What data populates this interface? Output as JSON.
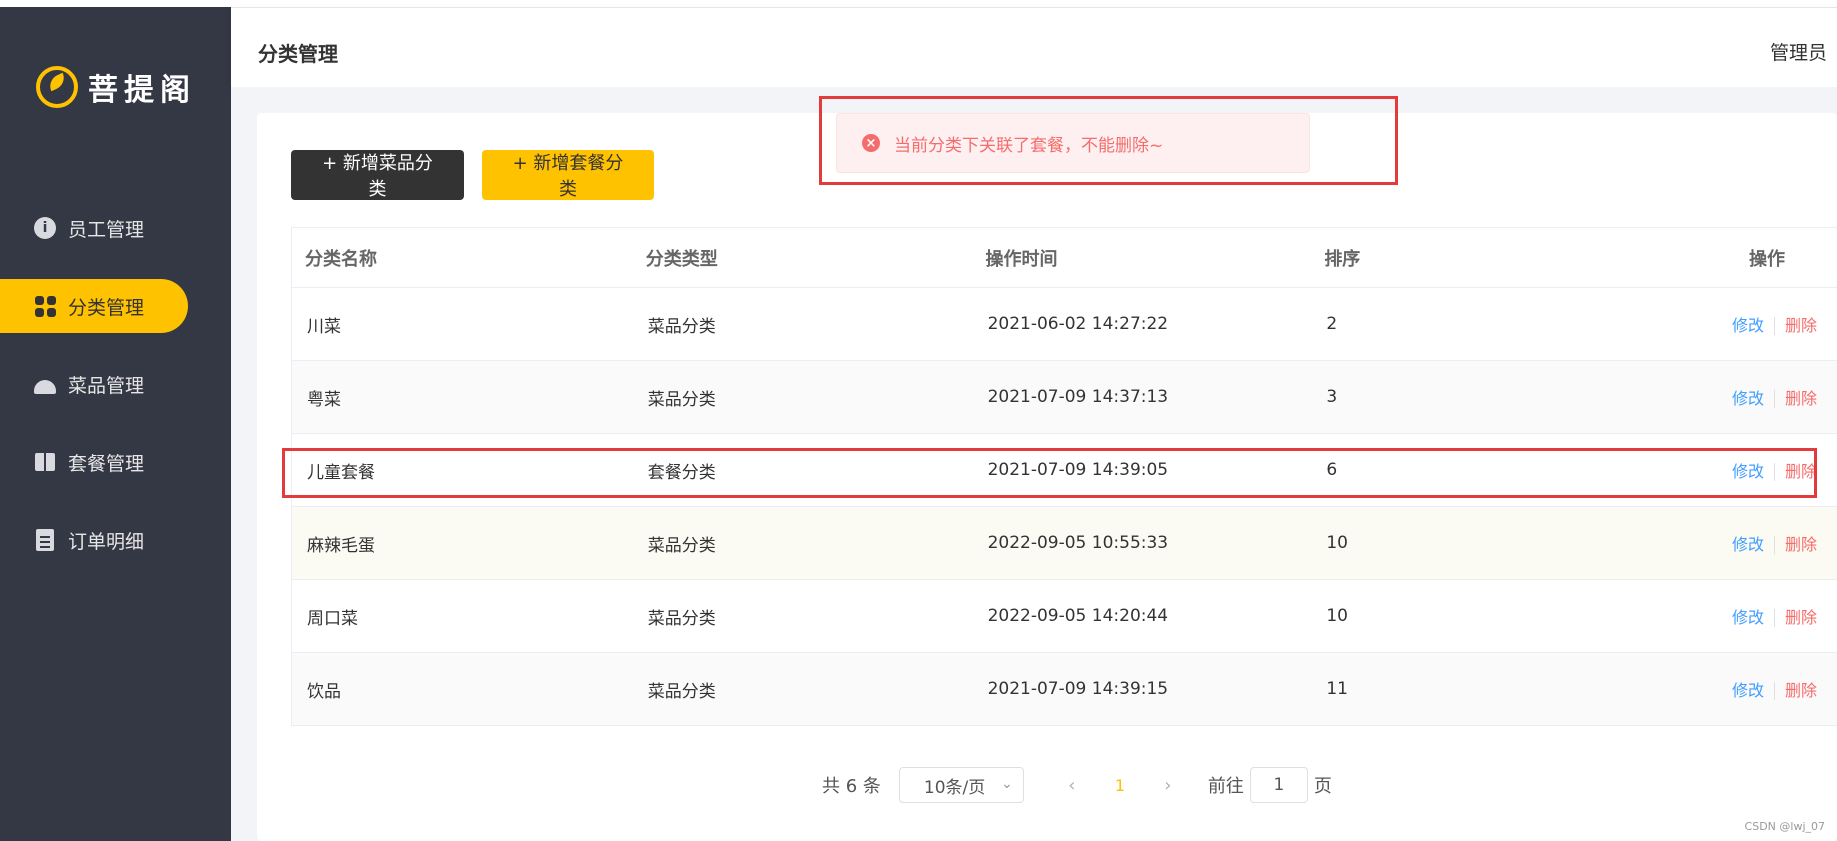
{
  "app": {
    "logo_text": "菩提阁"
  },
  "sidebar": {
    "items": [
      {
        "label": "员工管理",
        "icon": "info-icon",
        "active": false
      },
      {
        "label": "分类管理",
        "icon": "grid-icon",
        "active": true
      },
      {
        "label": "菜品管理",
        "icon": "cloche-icon",
        "active": false
      },
      {
        "label": "套餐管理",
        "icon": "gift-icon",
        "active": false
      },
      {
        "label": "订单明细",
        "icon": "clipboard-icon",
        "active": false
      }
    ]
  },
  "header": {
    "title": "分类管理",
    "user": "管理员"
  },
  "toolbar": {
    "add_dish_category": "+ 新增菜品分类",
    "add_setmeal_category": "+ 新增套餐分类"
  },
  "toast": {
    "type": "error",
    "message": "当前分类下关联了套餐，不能删除~",
    "color": "#f56c6c"
  },
  "table": {
    "headers": {
      "name": "分类名称",
      "type": "分类类型",
      "time": "操作时间",
      "sort": "排序",
      "op": "操作"
    },
    "rows": [
      {
        "name": "川菜",
        "type": "菜品分类",
        "time": "2021-06-02 14:27:22",
        "sort": "2",
        "edit": "修改",
        "del": "删除"
      },
      {
        "name": "粤菜",
        "type": "菜品分类",
        "time": "2021-07-09 14:37:13",
        "sort": "3",
        "edit": "修改",
        "del": "删除"
      },
      {
        "name": "儿童套餐",
        "type": "套餐分类",
        "time": "2021-07-09 14:39:05",
        "sort": "6",
        "edit": "修改",
        "del": "删除"
      },
      {
        "name": "麻辣毛蛋",
        "type": "菜品分类",
        "time": "2022-09-05 10:55:33",
        "sort": "10",
        "edit": "修改",
        "del": "删除"
      },
      {
        "name": "周口菜",
        "type": "菜品分类",
        "time": "2022-09-05 14:20:44",
        "sort": "10",
        "edit": "修改",
        "del": "删除"
      },
      {
        "name": "饮品",
        "type": "菜品分类",
        "time": "2021-07-09 14:39:15",
        "sort": "11",
        "edit": "修改",
        "del": "删除"
      }
    ]
  },
  "pagination": {
    "total": "共 6 条",
    "page_size": "10条/页",
    "prev": "‹",
    "current": "1",
    "next": "›",
    "goto_label": "前往",
    "goto_value": "1",
    "goto_unit": "页"
  },
  "watermark": "CSDN @lwj_07",
  "colors": {
    "sidebar_bg": "#343744",
    "accent": "#ffc200",
    "error": "#f56c6c",
    "link": "#419eff"
  }
}
